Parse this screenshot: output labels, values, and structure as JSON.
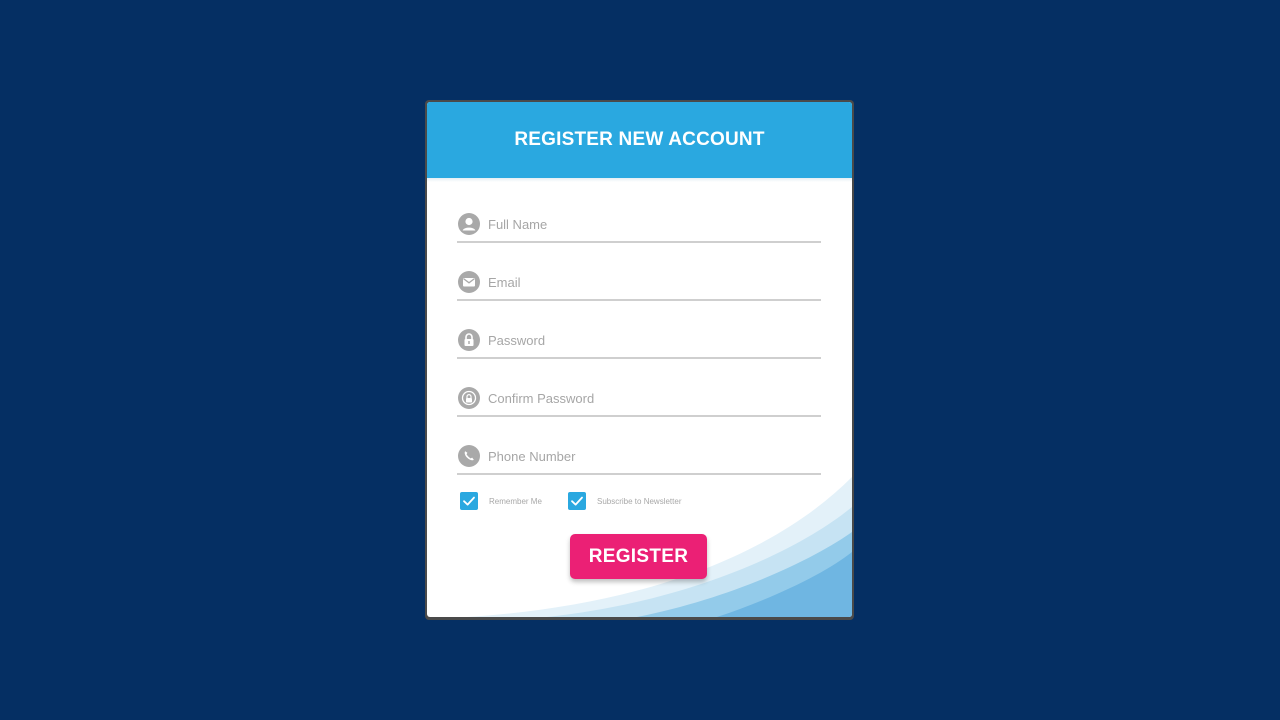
{
  "form": {
    "title": "REGISTER NEW ACCOUNT",
    "fields": [
      {
        "name": "full-name",
        "placeholder": "Full Name",
        "icon": "user-icon",
        "value": ""
      },
      {
        "name": "email",
        "placeholder": "Email",
        "icon": "envelope-icon",
        "value": ""
      },
      {
        "name": "password",
        "placeholder": "Password",
        "icon": "lock-icon",
        "value": ""
      },
      {
        "name": "confirm-password",
        "placeholder": "Confirm Password",
        "icon": "lock-check-icon",
        "value": ""
      },
      {
        "name": "phone-number",
        "placeholder": "Phone Number",
        "icon": "phone-icon",
        "value": ""
      }
    ],
    "checkboxes": [
      {
        "label": "Remember Me",
        "checked": true
      },
      {
        "label": "Subscribe to Newsletter",
        "checked": true
      }
    ],
    "submit_label": "REGISTER"
  },
  "colors": {
    "background": "#052f63",
    "header": "#2aa8e0",
    "button": "#eb2075",
    "icon": "#a9a9a9",
    "checkbox": "#2aa8e0"
  }
}
